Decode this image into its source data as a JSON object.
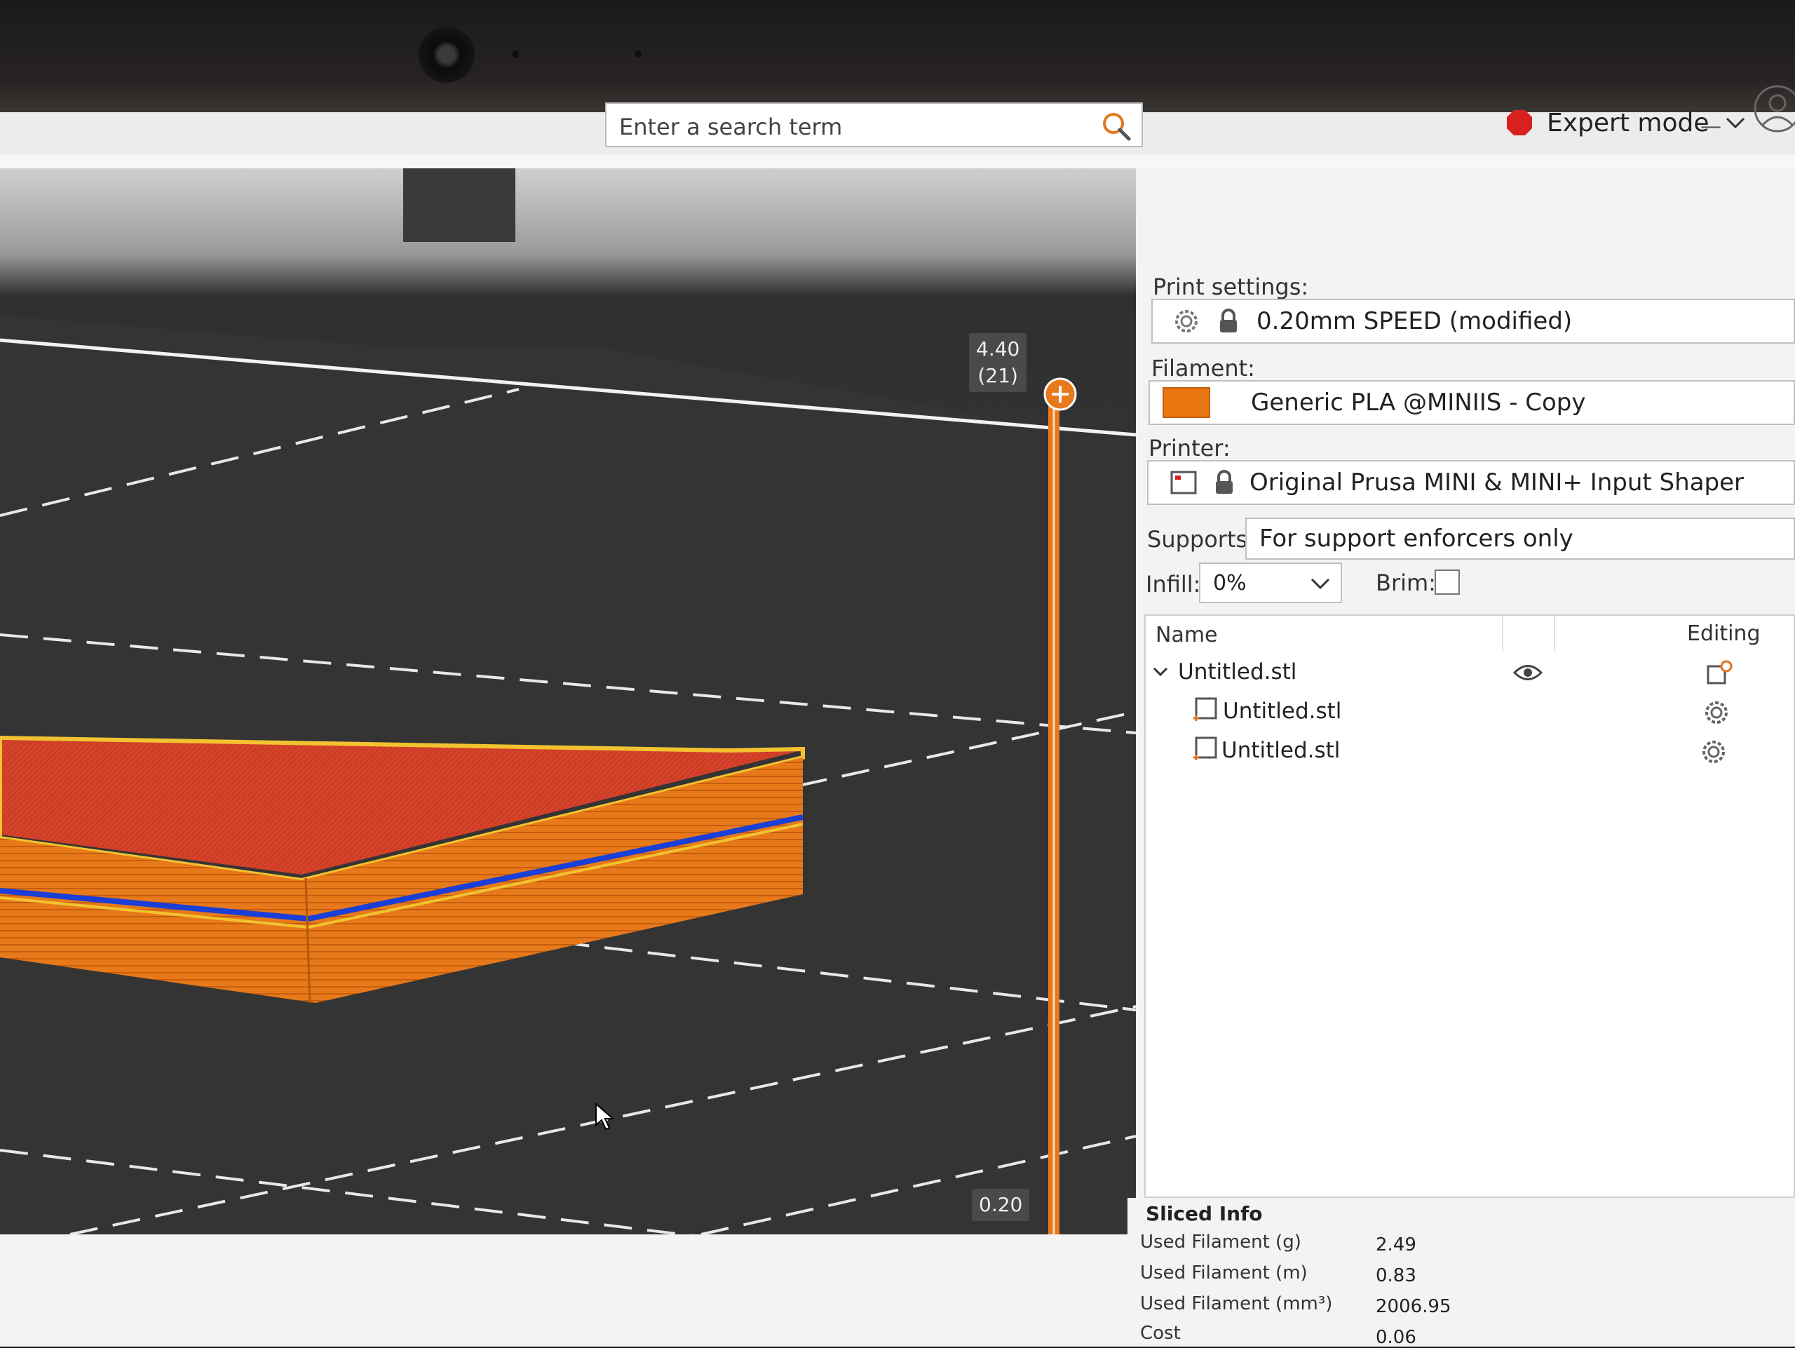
{
  "toolbar": {
    "search_placeholder": "Enter a search term",
    "mode_label": "Expert mode",
    "mode_color": "#d92020"
  },
  "viewport": {
    "layer_top_height": "4.40",
    "layer_top_index": "(21)",
    "layer_bottom_height": "0.20",
    "slider_color": "#e87712"
  },
  "sidebar": {
    "print_settings_label": "Print settings:",
    "print_settings_value": "0.20mm SPEED (modified)",
    "filament_label": "Filament:",
    "filament_value": "Generic PLA @MINIIS - Copy",
    "filament_color": "#e87712",
    "printer_label": "Printer:",
    "printer_value": "Original Prusa MINI & MINI+ Input Shaper",
    "supports_label": "Supports:",
    "supports_value": "For support enforcers only",
    "infill_label": "Infill:",
    "infill_value": "0%",
    "brim_label": "Brim:",
    "brim_checked": false
  },
  "object_list": {
    "col_name": "Name",
    "col_editing": "Editing",
    "items": [
      {
        "name": "Untitled.stl"
      },
      {
        "name": "Untitled.stl"
      },
      {
        "name": "Untitled.stl"
      }
    ]
  },
  "sliced_info": {
    "title": "Sliced Info",
    "rows": [
      {
        "key": "Used Filament (g)",
        "value": "2.49"
      },
      {
        "key": "Used Filament (m)",
        "value": "0.83"
      },
      {
        "key": "Used Filament (mm³)",
        "value": "2006.95"
      },
      {
        "key": "Cost",
        "value": "0.06"
      }
    ]
  }
}
